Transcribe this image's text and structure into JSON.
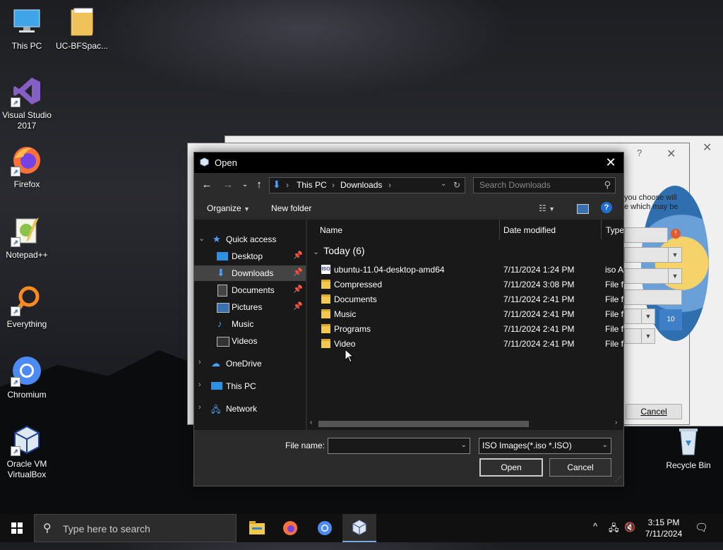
{
  "desktop": {
    "icons": [
      {
        "label": "This PC",
        "icon": "this-pc-icon"
      },
      {
        "label": "UC-BFSpac...",
        "icon": "folder-icon"
      },
      {
        "label": "Visual Studio 2017",
        "icon": "visual-studio-icon"
      },
      {
        "label": "Firefox",
        "icon": "firefox-icon"
      },
      {
        "label": "Notepad++",
        "icon": "notepad-plus-plus-icon"
      },
      {
        "label": "Everything",
        "icon": "everything-icon"
      },
      {
        "label": "Chromium",
        "icon": "chromium-icon"
      },
      {
        "label": "Oracle VM VirtualBox",
        "icon": "virtualbox-icon"
      },
      {
        "label": "Recycle Bin",
        "icon": "recycle-bin-icon"
      }
    ]
  },
  "background_window": {
    "text_line1": "you choose will",
    "text_line2": "e which may be",
    "cancel_label": "Cancel"
  },
  "dialog": {
    "title": "Open",
    "close_glyph": "✕",
    "address": {
      "segments": [
        "This PC",
        "Downloads"
      ]
    },
    "search_placeholder": "Search Downloads",
    "toolbar": {
      "organize": "Organize",
      "new_folder": "New folder",
      "help": "?"
    },
    "nav": {
      "quick_access": "Quick access",
      "desktop": "Desktop",
      "downloads": "Downloads",
      "documents": "Documents",
      "pictures": "Pictures",
      "music": "Music",
      "videos": "Videos",
      "onedrive": "OneDrive",
      "this_pc": "This PC",
      "network": "Network"
    },
    "columns": {
      "name": "Name",
      "date": "Date modified",
      "type": "Type"
    },
    "group": "Today (6)",
    "files": [
      {
        "name": "ubuntu-11.04-desktop-amd64",
        "date": "7/11/2024 1:24 PM",
        "type": "iso A",
        "kind": "iso"
      },
      {
        "name": "Compressed",
        "date": "7/11/2024 3:08 PM",
        "type": "File fo",
        "kind": "folder"
      },
      {
        "name": "Documents",
        "date": "7/11/2024 2:41 PM",
        "type": "File fo",
        "kind": "folder"
      },
      {
        "name": "Music",
        "date": "7/11/2024 2:41 PM",
        "type": "File fo",
        "kind": "folder"
      },
      {
        "name": "Programs",
        "date": "7/11/2024 2:41 PM",
        "type": "File fo",
        "kind": "folder"
      },
      {
        "name": "Video",
        "date": "7/11/2024 2:41 PM",
        "type": "File fo",
        "kind": "folder"
      }
    ],
    "file_name_label": "File name:",
    "file_name_value": "",
    "file_type": "ISO Images(*.iso *.ISO)",
    "open_label": "Open",
    "cancel_label": "Cancel"
  },
  "taskbar": {
    "search_placeholder": "Type here to search",
    "apps": [
      "file-explorer-icon",
      "firefox-icon",
      "chromium-icon",
      "virtualbox-icon"
    ],
    "time": "3:15 PM",
    "date": "7/11/2024"
  }
}
